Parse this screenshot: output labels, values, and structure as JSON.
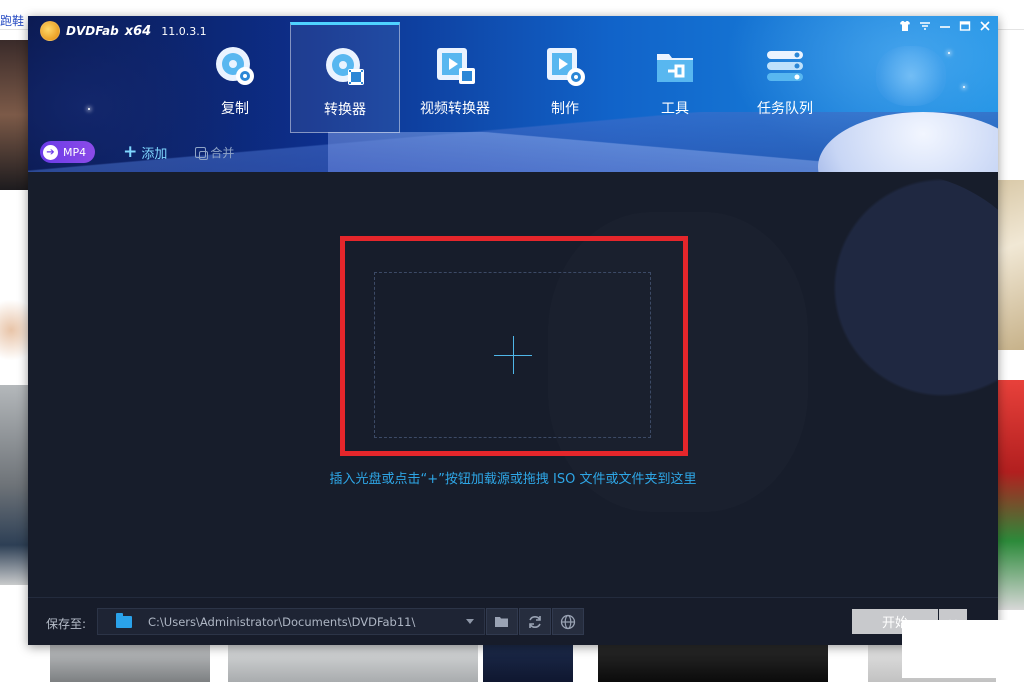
{
  "app": {
    "logo_text": "DVDFab",
    "arch": "x64",
    "version": "11.0.3.1"
  },
  "nav": [
    {
      "id": "copy",
      "label": "复制",
      "icon": "disc-copy-icon"
    },
    {
      "id": "ripper",
      "label": "转换器",
      "icon": "disc-film-icon",
      "active": true
    },
    {
      "id": "video-converter",
      "label": "视频转换器",
      "icon": "film-play-icon"
    },
    {
      "id": "creator",
      "label": "制作",
      "icon": "film-disc-icon"
    },
    {
      "id": "tools",
      "label": "工具",
      "icon": "folder-tool-icon"
    },
    {
      "id": "queue",
      "label": "任务队列",
      "icon": "stack-icon"
    }
  ],
  "subbar": {
    "profile_label": "MP4",
    "add_label": "添加",
    "merge_label": "合并"
  },
  "main": {
    "hint": "插入光盘或点击“+”按钮加载源或拖拽 ISO 文件或文件夹到这里"
  },
  "footer": {
    "save_label": "保存至:",
    "path": "C:\\Users\\Administrator\\Documents\\DVDFab11\\",
    "start_label": "开始"
  },
  "background": {
    "top_fragment": "跑鞋"
  },
  "colors": {
    "accent": "#2ea6e6",
    "highlight": "#e5262b",
    "profile_button": "#7a44e8"
  }
}
